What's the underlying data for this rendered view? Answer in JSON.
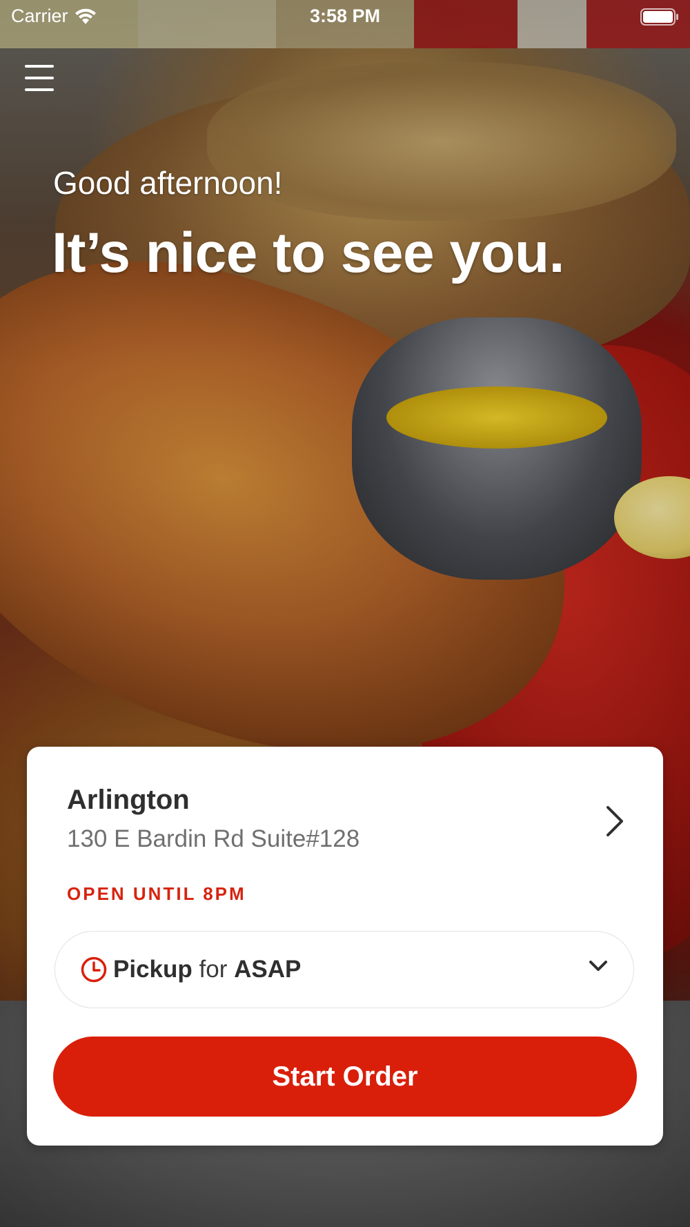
{
  "status_bar": {
    "carrier": "Carrier",
    "time": "3:58 PM"
  },
  "header": {
    "menu_icon": "hamburger-menu-icon"
  },
  "hero": {
    "greeting": "Good afternoon!",
    "headline": "It’s nice to see you."
  },
  "location": {
    "name": "Arlington",
    "address": "130 E Bardin Rd Suite#128",
    "hours": "OPEN UNTIL 8PM"
  },
  "order_options": {
    "method": "Pickup",
    "connector": "for",
    "time": "ASAP"
  },
  "actions": {
    "start_order_label": "Start Order"
  },
  "colors": {
    "accent": "#d91f0a",
    "hours_text": "#d7230f",
    "card_background": "#ffffff"
  }
}
